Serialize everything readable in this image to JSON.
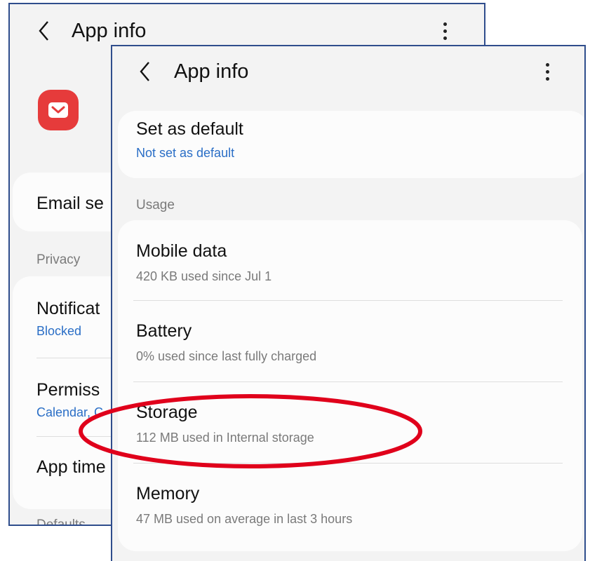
{
  "colors": {
    "frame_border": "#2f4d8c",
    "link_blue": "#2a6ec6",
    "highlight_red": "#e0001b",
    "app_icon_red": "#e63b3b"
  },
  "back_screen": {
    "title": "App info",
    "icons": [
      "chevron-left-icon",
      "more-vert-icon",
      "email-app-icon"
    ],
    "email_row": {
      "label": "Email se"
    },
    "privacy_label": "Privacy",
    "notifications": {
      "label": "Notificat",
      "value": "Blocked"
    },
    "permissions": {
      "label": "Permiss",
      "value": "Calendar, C"
    },
    "app_timer": {
      "label": "App time"
    },
    "defaults_label": "Defaults"
  },
  "front_screen": {
    "title": "App info",
    "icons": [
      "chevron-left-icon",
      "more-vert-icon"
    ],
    "set_default": {
      "label": "Set as default",
      "value": "Not set as default"
    },
    "usage_label": "Usage",
    "usage_items": [
      {
        "label": "Mobile data",
        "detail": "420 KB used since Jul 1"
      },
      {
        "label": "Battery",
        "detail": "0% used since last fully charged"
      },
      {
        "label": "Storage",
        "detail": "112 MB used in Internal storage"
      },
      {
        "label": "Memory",
        "detail": "47 MB used on average in last 3 hours"
      }
    ]
  },
  "annotation": {
    "highlighted_item": "Storage",
    "shape": "ellipse"
  }
}
